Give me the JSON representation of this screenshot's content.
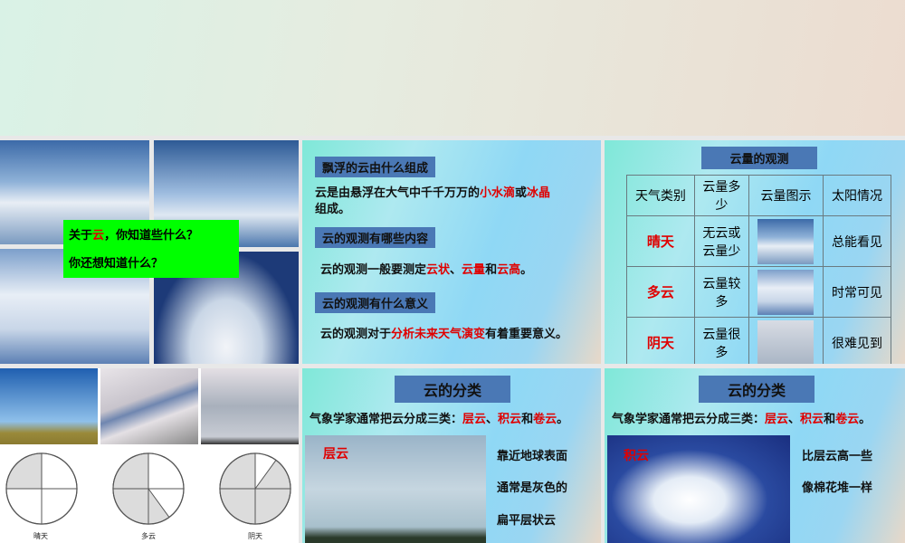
{
  "slide1": {
    "line1_prefix": "关于",
    "line1_red": "云",
    "line1_suffix": "，你知道些什么？",
    "line2": "你还想知道什么？"
  },
  "slide2": {
    "q1": "飘浮的云由什么组成",
    "a1_prefix": "云是由悬浮在大气中千千万万的",
    "a1_red1": "小水滴",
    "a1_mid": "或",
    "a1_red2": "冰晶",
    "a1_line2": "组成。",
    "q2": "云的观测有哪些内容",
    "a2_prefix": "云的观测一般要测定",
    "a2_red1": "云状",
    "a2_sep": "、",
    "a2_red2": "云量",
    "a2_mid": "和",
    "a2_red3": "云高",
    "a2_end": "。",
    "q3": "云的观测有什么意义",
    "a3_prefix": "云的观测对于",
    "a3_red": "分析未来天气演变",
    "a3_suffix": "有着重要意义。"
  },
  "slide3": {
    "title": "云量的观测",
    "headers": [
      "天气类别",
      "云量多少",
      "云量图示",
      "太阳情况"
    ],
    "rows": [
      {
        "type": "晴天",
        "amount": "无云或云量少",
        "sun": "总能看见"
      },
      {
        "type": "多云",
        "amount": "云量较多",
        "sun": "时常可见"
      },
      {
        "type": "阴天",
        "amount": "云量很多",
        "sun": "很难见到"
      }
    ]
  },
  "slide4": {
    "captions": [
      "晴天",
      "多云",
      "阴天"
    ],
    "cloud_fraction": [
      0.25,
      0.6,
      0.9
    ]
  },
  "slide5": {
    "title": "云的分类",
    "intro_prefix": "气象学家通常把云分成三类：",
    "t1": "层云",
    "sep": "、",
    "t2": "积云",
    "and": "和",
    "t3": "卷云",
    "end": "。",
    "photo_label": "层云",
    "desc": [
      "靠近地球表面",
      "通常是灰色的",
      "扁平层状云"
    ]
  },
  "slide6": {
    "title": "云的分类",
    "photo_label": "积云",
    "desc": [
      "比层云高一些",
      "像棉花堆一样"
    ]
  }
}
